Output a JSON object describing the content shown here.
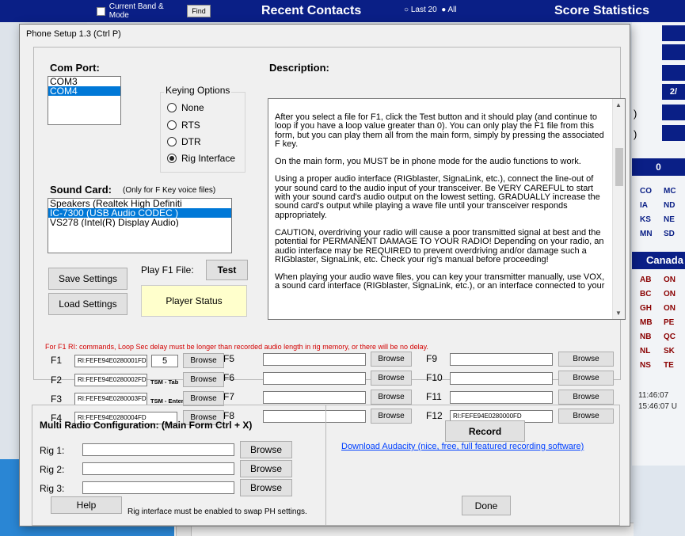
{
  "background": {
    "current_band_label": "Current Band & Mode",
    "find_label": "Find",
    "recent_contacts_title": "Recent Contacts",
    "last20_label": "Last 20",
    "all_label": "All",
    "score_stats_title": "Score Statistics",
    "stat_value": "2/",
    "zero": "0",
    "paren": ")",
    "states": [
      "CO",
      "MC",
      "IA",
      "ND",
      "KS",
      "NE",
      "MN",
      "SD"
    ],
    "canada_title": "Canada",
    "provinces": [
      "AB",
      "ON",
      "BC",
      "ON",
      "GH",
      "ON",
      "MB",
      "PE",
      "NB",
      "QC",
      "NL",
      "SK",
      "NS",
      "TE"
    ],
    "time_local": "11:46:07",
    "time_utc": "15:46:07  U"
  },
  "dialog": {
    "title": "Phone Setup 1.3   (Ctrl P)",
    "com_port_label": "Com Port:",
    "com_ports": [
      "COM3",
      "COM4"
    ],
    "com_selected_index": 1,
    "keying_title": "Keying Options",
    "keying_options": [
      "None",
      "RTS",
      "DTR",
      "Rig Interface"
    ],
    "keying_selected": "Rig Interface",
    "description_label": "Description:",
    "description_paragraphs": [
      "After you select a file for F1, click the Test button and it should play (and continue to loop if you have a loop value greater than 0).  You can only play the F1 file from this form, but you can play them all from the main form, simply by pressing the associated F key.",
      "On the main form, you MUST be in phone mode for the audio functions to work.",
      "Using a proper audio interface (RIGblaster, SignaLink, etc.), connect the line-out of your sound card to the audio input of your transceiver.  Be VERY CAREFUL to start with your sound card's audio output on the lowest setting.  GRADUALLY increase the sound card's output while playing a wave file until your transceiver responds appropriately.",
      "CAUTION, overdriving your radio will cause a poor transmitted signal at best and the potential for PERMANENT DAMAGE TO YOUR RADIO!  Depending on your radio, an audio interface may be REQUIRED to prevent overdriving and/or damage such a RIGblaster, SignaLink, etc.  Check your rig's manual before proceeding!",
      "When playing your audio wave files, you can key your transmitter manually, use VOX, a sound card interface (RIGblaster, SignaLink, etc.), or an interface connected to your"
    ],
    "sound_card_label": "Sound Card:",
    "sound_card_hint": "(Only for F Key voice files)",
    "sound_cards": [
      "Speakers (Realtek High Definiti",
      "IC-7300 (USB Audio CODEC )",
      "VS278 (Intel(R) Display Audio)"
    ],
    "sound_selected_index": 1,
    "play_f1_label": "Play F1 File:",
    "test_label": "Test",
    "save_settings_label": "Save Settings",
    "load_settings_label": "Load Settings",
    "player_status_label": "Player Status",
    "warning_note": "For F1 RI: commands, Loop Sec delay must be longer than recorded audio length in rig memory, or there will be no delay.",
    "browse_label": "Browse",
    "loop_value": "5",
    "tsm_tab": "TSM - Tab",
    "tsm_enter": "TSM - Enter",
    "fkeys": [
      {
        "key": "F1",
        "value": "RI:FEFE94E0280001FD"
      },
      {
        "key": "F2",
        "value": "RI:FEFE94E0280002FD"
      },
      {
        "key": "F3",
        "value": "RI:FEFE94E0280003FD"
      },
      {
        "key": "F4",
        "value": "RI:FEFE94E0280004FD"
      },
      {
        "key": "F5",
        "value": ""
      },
      {
        "key": "F6",
        "value": ""
      },
      {
        "key": "F7",
        "value": ""
      },
      {
        "key": "F8",
        "value": ""
      },
      {
        "key": "F9",
        "value": ""
      },
      {
        "key": "F10",
        "value": ""
      },
      {
        "key": "F11",
        "value": ""
      },
      {
        "key": "F12",
        "value": "RI:FEFE94E0280000FD"
      }
    ],
    "multi_radio_title": "Multi Radio Configuration: (Main Form Ctrl + X)",
    "rigs": [
      {
        "label": "Rig 1:",
        "value": ""
      },
      {
        "label": "Rig 2:",
        "value": ""
      },
      {
        "label": "Rig 3:",
        "value": ""
      }
    ],
    "help_label": "Help",
    "rig_note": "Rig interface must be enabled to swap PH settings.",
    "record_label": "Record",
    "audacity_link": "Download Audacity (nice, free, full featured recording software)",
    "done_label": "Done"
  }
}
